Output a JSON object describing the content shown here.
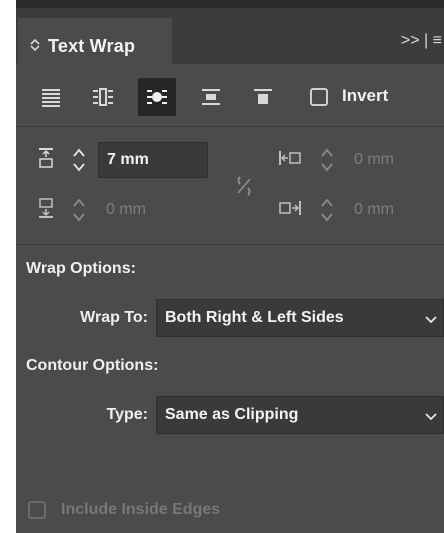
{
  "panel": {
    "tab_title": "Text Wrap",
    "tab_menu_glyphs": ">>  |  ≡",
    "invert_label": "Invert",
    "offsets": {
      "top": "7 mm",
      "bottom": "0 mm",
      "left": "0 mm",
      "right": "0 mm"
    },
    "wrap_options_label": "Wrap Options:",
    "wrap_to_label": "Wrap To:",
    "wrap_to_value": "Both Right & Left Sides",
    "contour_options_label": "Contour Options:",
    "type_label": "Type:",
    "type_value": "Same as Clipping",
    "include_inside_edges_label": "Include Inside Edges",
    "icons": [
      "no-wrap-icon",
      "wrap-around-bounding-box-icon",
      "wrap-around-object-shape-icon",
      "jump-object-icon",
      "jump-to-next-column-icon"
    ],
    "active_wrap_mode": "wrap-around-object-shape-icon"
  }
}
